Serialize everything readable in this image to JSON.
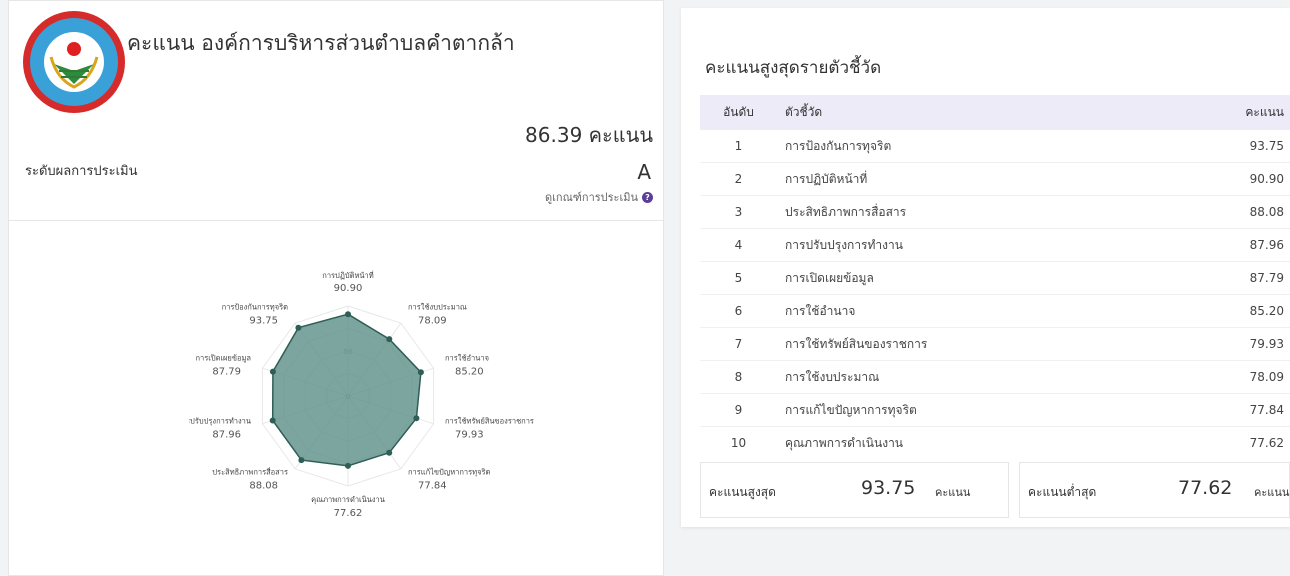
{
  "organization": {
    "title": "คะแนน องค์การบริหารส่วนตำบลคำตากล้า",
    "logo_icon": "organization-seal-logo"
  },
  "summary": {
    "total_score": "86.39 คะแนน",
    "level_label": "ระดับผลการประเมิน",
    "grade": "A",
    "criteria_link": "ดูเกณฑ์การประเมิน",
    "criteria_icon": "question-circle-icon"
  },
  "chart_data": {
    "type": "radar",
    "axis_ticks": [
      "0",
      "50"
    ],
    "range": [
      0,
      100
    ],
    "fill_color": "#5a8f86",
    "stroke_color": "#2f5e57",
    "categories": [
      {
        "name": "การปฏิบัติหน้าที่",
        "value": 90.9,
        "label": "90.90"
      },
      {
        "name": "การใช้งบประมาณ",
        "value": 78.09,
        "label": "78.09"
      },
      {
        "name": "การใช้อำนาจ",
        "value": 85.2,
        "label": "85.20"
      },
      {
        "name": "การใช้ทรัพย์สินของราชการ",
        "value": 79.93,
        "label": "79.93"
      },
      {
        "name": "การแก้ไขปัญหาการทุจริต",
        "value": 77.84,
        "label": "77.84"
      },
      {
        "name": "คุณภาพการดำเนินงาน",
        "value": 77.62,
        "label": "77.62"
      },
      {
        "name": "ประสิทธิภาพการสื่อสาร",
        "value": 88.08,
        "label": "88.08"
      },
      {
        "name": "การปรับปรุงการทำงาน",
        "value": 87.96,
        "label": "87.96"
      },
      {
        "name": "การเปิดเผยข้อมูล",
        "value": 87.79,
        "label": "87.79"
      },
      {
        "name": "การป้องกันการทุจริต",
        "value": 93.75,
        "label": "93.75"
      }
    ]
  },
  "ranking": {
    "title": "คะแนนสูงสุดรายตัวชี้วัด",
    "headers": {
      "rank": "อันดับ",
      "indicator": "ตัวชี้วัด",
      "score": "คะแนน"
    },
    "rows": [
      {
        "rank": "1",
        "name": "การป้องกันการทุจริต",
        "score": "93.75"
      },
      {
        "rank": "2",
        "name": "การปฏิบัติหน้าที่",
        "score": "90.90"
      },
      {
        "rank": "3",
        "name": "ประสิทธิภาพการสื่อสาร",
        "score": "88.08"
      },
      {
        "rank": "4",
        "name": "การปรับปรุงการทำงาน",
        "score": "87.96"
      },
      {
        "rank": "5",
        "name": "การเปิดเผยข้อมูล",
        "score": "87.79"
      },
      {
        "rank": "6",
        "name": "การใช้อำนาจ",
        "score": "85.20"
      },
      {
        "rank": "7",
        "name": "การใช้ทรัพย์สินของราชการ",
        "score": "79.93"
      },
      {
        "rank": "8",
        "name": "การใช้งบประมาณ",
        "score": "78.09"
      },
      {
        "rank": "9",
        "name": "การแก้ไขปัญหาการทุจริต",
        "score": "77.84"
      },
      {
        "rank": "10",
        "name": "คุณภาพการดำเนินงาน",
        "score": "77.62"
      }
    ]
  },
  "stats": {
    "max": {
      "label": "คะแนนสูงสุด",
      "value": "93.75",
      "unit": "คะแนน"
    },
    "min": {
      "label": "คะแนนต่ำสุด",
      "value": "77.62",
      "unit": "คะแนน"
    }
  }
}
